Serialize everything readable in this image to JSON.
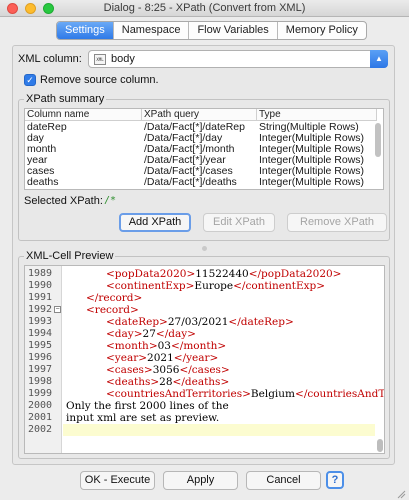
{
  "window": {
    "title": "Dialog - 8:25 - XPath (Convert from XML)"
  },
  "tabs": [
    {
      "label": "Settings"
    },
    {
      "label": "Namespace"
    },
    {
      "label": "Flow Variables"
    },
    {
      "label": "Memory Policy"
    }
  ],
  "xml_column": {
    "label": "XML column:",
    "value": "body",
    "icon": "xml-cell-icon"
  },
  "remove_source": {
    "label": "Remove source column.",
    "checked": true
  },
  "xpath_summary": {
    "legend": "XPath summary",
    "columns": [
      "Column name",
      "XPath query",
      "Type"
    ],
    "rows": [
      [
        "dateRep",
        "/Data/Fact[*]/dateRep",
        "String(Multiple Rows)"
      ],
      [
        "day",
        "/Data/Fact[*]/day",
        "Integer(Multiple Rows)"
      ],
      [
        "month",
        "/Data/Fact[*]/month",
        "Integer(Multiple Rows)"
      ],
      [
        "year",
        "/Data/Fact[*]/year",
        "Integer(Multiple Rows)"
      ],
      [
        "cases",
        "/Data/Fact[*]/cases",
        "Integer(Multiple Rows)"
      ],
      [
        "deaths",
        "/Data/Fact[*]/deaths",
        "Integer(Multiple Rows)"
      ]
    ],
    "selected_label": "Selected XPath:",
    "selected_value": "/*",
    "add_button": "Add XPath",
    "edit_button": "Edit XPath",
    "remove_button": "Remove XPath"
  },
  "preview": {
    "legend": "XML-Cell Preview",
    "lines": [
      {
        "num": "1989",
        "indent": 3,
        "parts": [
          [
            "tag",
            "<popData2020>"
          ],
          [
            "txt",
            "11522440"
          ],
          [
            "tag",
            "</popData2020>"
          ]
        ]
      },
      {
        "num": "1990",
        "indent": 3,
        "parts": [
          [
            "tag",
            "<continentExp>"
          ],
          [
            "txt",
            "Europe"
          ],
          [
            "tag",
            "</continentExp>"
          ]
        ]
      },
      {
        "num": "1991",
        "indent": 2,
        "parts": [
          [
            "tag",
            "</record>"
          ]
        ]
      },
      {
        "num": "1992",
        "indent": 2,
        "fold": true,
        "parts": [
          [
            "tag",
            "<record>"
          ]
        ]
      },
      {
        "num": "1993",
        "indent": 3,
        "parts": [
          [
            "tag",
            "<dateRep>"
          ],
          [
            "txt",
            "27/03/2021"
          ],
          [
            "tag",
            "</dateRep>"
          ]
        ]
      },
      {
        "num": "1994",
        "indent": 3,
        "parts": [
          [
            "tag",
            "<day>"
          ],
          [
            "txt",
            "27"
          ],
          [
            "tag",
            "</day>"
          ]
        ]
      },
      {
        "num": "1995",
        "indent": 3,
        "parts": [
          [
            "tag",
            "<month>"
          ],
          [
            "txt",
            "03"
          ],
          [
            "tag",
            "</month>"
          ]
        ]
      },
      {
        "num": "1996",
        "indent": 3,
        "parts": [
          [
            "tag",
            "<year>"
          ],
          [
            "txt",
            "2021"
          ],
          [
            "tag",
            "</year>"
          ]
        ]
      },
      {
        "num": "1997",
        "indent": 3,
        "parts": [
          [
            "tag",
            "<cases>"
          ],
          [
            "txt",
            "3056"
          ],
          [
            "tag",
            "</cases>"
          ]
        ]
      },
      {
        "num": "1998",
        "indent": 3,
        "parts": [
          [
            "tag",
            "<deaths>"
          ],
          [
            "txt",
            "28"
          ],
          [
            "tag",
            "</deaths>"
          ]
        ]
      },
      {
        "num": "1999",
        "indent": 3,
        "parts": [
          [
            "tag",
            "<countriesAndTerritories>"
          ],
          [
            "txt",
            "Belgium"
          ],
          [
            "tag",
            "</countriesAndTerrit"
          ]
        ]
      },
      {
        "num": "2000",
        "indent": 0,
        "parts": [
          [
            "txt",
            "Only the first 2000 lines of the"
          ]
        ]
      },
      {
        "num": "2001",
        "indent": 0,
        "parts": [
          [
            "txt",
            "input xml are set as preview."
          ]
        ]
      },
      {
        "num": "2002",
        "indent": 0,
        "highlight": true,
        "parts": []
      }
    ]
  },
  "footer": {
    "ok": "OK - Execute",
    "apply": "Apply",
    "cancel": "Cancel",
    "help": "?"
  },
  "colors": {
    "accent": "#2f7ae8",
    "tag": "#c00000"
  }
}
